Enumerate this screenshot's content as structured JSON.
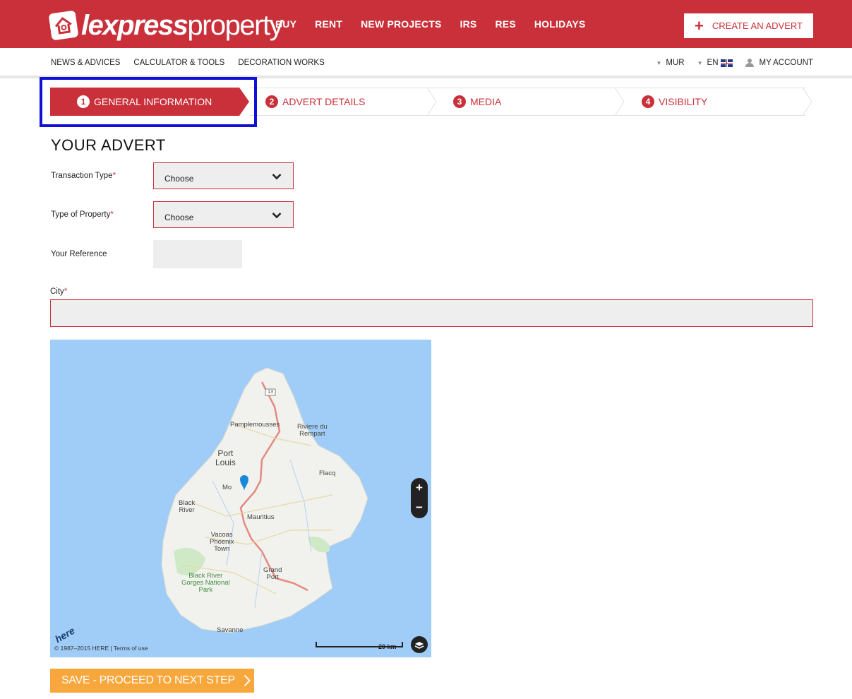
{
  "header": {
    "logo_bold": "lexpress",
    "logo_light": "property",
    "nav": [
      "BUY",
      "RENT",
      "NEW PROJECTS",
      "IRS",
      "RES",
      "HOLIDAYS"
    ],
    "create_advert": "CREATE AN ADVERT",
    "brand_color": "#c9303a"
  },
  "subnav": {
    "links": [
      "NEWS & ADVICES",
      "CALCULATOR & TOOLS",
      "DECORATION WORKS"
    ],
    "currency": "MUR",
    "language": "EN",
    "account": "MY ACCOUNT"
  },
  "steps": [
    {
      "num": "1",
      "label": "GENERAL INFORMATION",
      "active": true
    },
    {
      "num": "2",
      "label": "ADVERT DETAILS",
      "active": false
    },
    {
      "num": "3",
      "label": "MEDIA",
      "active": false
    },
    {
      "num": "4",
      "label": "VISIBILITY",
      "active": false
    }
  ],
  "form": {
    "title": "YOUR ADVERT",
    "transaction_type_label": "Transaction Type",
    "transaction_type_value": "Choose",
    "property_type_label": "Type of Property",
    "property_type_value": "Choose",
    "reference_label": "Your Reference",
    "reference_value": "",
    "city_label": "City",
    "city_value": "",
    "required_mark": "*"
  },
  "map": {
    "labels": {
      "route": "13",
      "pamplemousses": "Pamplemousses",
      "riviere_line1": "Riviere du",
      "riviere_line2": "Rempart",
      "port_line1": "Port",
      "port_line2": "Louis",
      "flacq": "Flacq",
      "mo": "Mo",
      "black_line1": "Black",
      "black_line2": "River",
      "mauritius": "Mauritius",
      "vacoas_line1": "Vacoas",
      "vacoas_line2": "Phoenix",
      "vacoas_line3": "Town",
      "grand_line1": "Grand",
      "grand_line2": "Port",
      "park_line1": "Black River",
      "park_line2": "Gorges National",
      "park_line3": "Park",
      "savanne": "Savanne"
    },
    "zoom_in": "+",
    "zoom_out": "−",
    "copyright": "© 1987–2015 HERE | Terms of use",
    "scale": "20 km",
    "provider": "here"
  },
  "save_button": "SAVE - PROCEED TO NEXT STEP"
}
